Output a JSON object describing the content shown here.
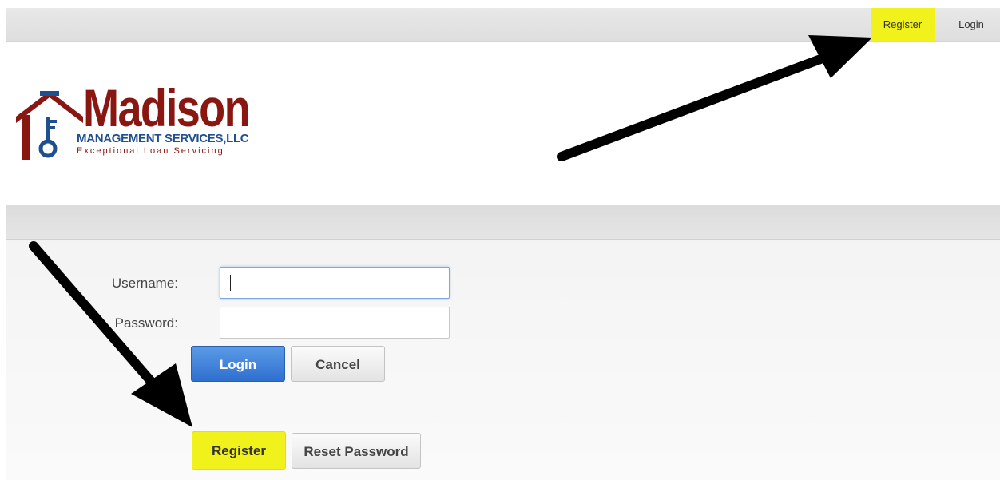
{
  "nav": {
    "register_label": "Register",
    "login_label": "Login"
  },
  "logo": {
    "name": "Madison",
    "line1": "MANAGEMENT SERVICES,LLC",
    "line2": "Exceptional Loan Servicing"
  },
  "form": {
    "username_label": "Username:",
    "username_value": "",
    "password_label": "Password:",
    "password_value": "",
    "login_button": "Login",
    "cancel_button": "Cancel",
    "register_button": "Register",
    "reset_button": "Reset Password"
  },
  "colors": {
    "highlight": "#f1f11b",
    "primary_button": "#2f6fd0",
    "brand_red": "#8a1612",
    "brand_blue": "#1f4f8f"
  }
}
